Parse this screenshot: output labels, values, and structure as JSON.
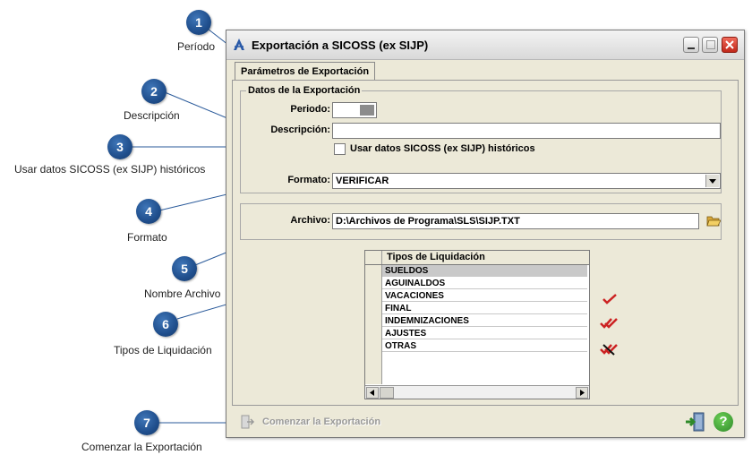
{
  "window": {
    "title": "Exportación a SICOSS (ex SIJP)",
    "tab": "Parámetros de Exportación"
  },
  "group_export": {
    "title": "Datos de la Exportación",
    "periodo_label": "Periodo:",
    "descripcion_label": "Descripción:",
    "descripcion_value": "",
    "historicos_label": "Usar datos SICOSS (ex SIJP) históricos",
    "formato_label": "Formato:",
    "formato_value": "VERIFICAR"
  },
  "archivo": {
    "label": "Archivo:",
    "value": "D:\\Archivos de Programa\\SLS\\SIJP.TXT"
  },
  "liquidaciones": {
    "header": "Tipos de Liquidación",
    "rows": [
      "SUELDOS",
      "AGUINALDOS",
      "VACACIONES",
      "FINAL",
      "INDEMNIZACIONES",
      "AJUSTES",
      "OTRAS"
    ]
  },
  "footer": {
    "start_label": "Comenzar la Exportación"
  },
  "callouts": [
    {
      "num": "1",
      "label": "Período"
    },
    {
      "num": "2",
      "label": "Descripción"
    },
    {
      "num": "3",
      "label": "Usar datos SICOSS (ex SIJP) históricos"
    },
    {
      "num": "4",
      "label": "Formato"
    },
    {
      "num": "5",
      "label": "Nombre Archivo"
    },
    {
      "num": "6",
      "label": "Tipos de Liquidación"
    },
    {
      "num": "7",
      "label": "Comenzar la Exportación"
    }
  ],
  "colors": {
    "marker": "#1f4e8c",
    "check_red": "#cc2222",
    "help_green": "#3a9a2e"
  }
}
